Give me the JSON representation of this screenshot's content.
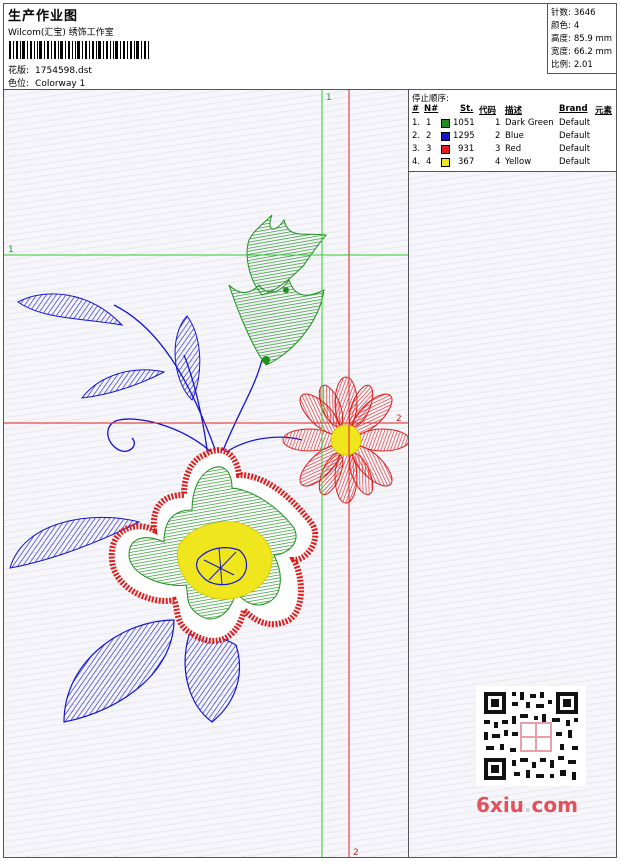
{
  "header": {
    "title": "生产作业图",
    "company": "Wilcom(汇宝) 绣饰工作室",
    "design_label": "花版:",
    "design_file": "1754598.dst",
    "colorway_label": "色位:",
    "colorway": "Colorway 1"
  },
  "stats": [
    {
      "label": "针数:",
      "value": "3646"
    },
    {
      "label": "颜色:",
      "value": "4"
    },
    {
      "label": "高度:",
      "value": "85.9 mm"
    },
    {
      "label": "宽度:",
      "value": "66.2 mm"
    },
    {
      "label": "比例:",
      "value": "2.01"
    }
  ],
  "sequence": {
    "title": "停止顺序:",
    "headers": {
      "num": "#",
      "no": "N#",
      "st": "St.",
      "code": "代码",
      "desc": "描述",
      "brand": "Brand",
      "elem": "元素"
    },
    "rows": [
      {
        "num": "1.",
        "no": "1",
        "color": "#1e8f1e",
        "st": "1051",
        "code": "1",
        "desc": "Dark Green",
        "brand": "Default"
      },
      {
        "num": "2.",
        "no": "2",
        "color": "#1414d2",
        "st": "1295",
        "code": "2",
        "desc": "Blue",
        "brand": "Default"
      },
      {
        "num": "3.",
        "no": "3",
        "color": "#e01e1e",
        "st": "931",
        "code": "3",
        "desc": "Red",
        "brand": "Default"
      },
      {
        "num": "4.",
        "no": "4",
        "color": "#f0e61e",
        "st": "367",
        "code": "4",
        "desc": "Yellow",
        "brand": "Default"
      }
    ]
  },
  "guides": {
    "v1_label": "1",
    "v2_label": "2",
    "h1_label": "1",
    "h2_label": "2",
    "v1_color": "#33cc33",
    "v2_color": "#dd2222"
  },
  "colors": {
    "green": "#1e8f1e",
    "blue": "#1414d2",
    "red": "#e01e1e",
    "yellow": "#f0e61e"
  },
  "watermark": {
    "text_a": "6xiu",
    "text_dot": ".",
    "text_b": "com"
  }
}
